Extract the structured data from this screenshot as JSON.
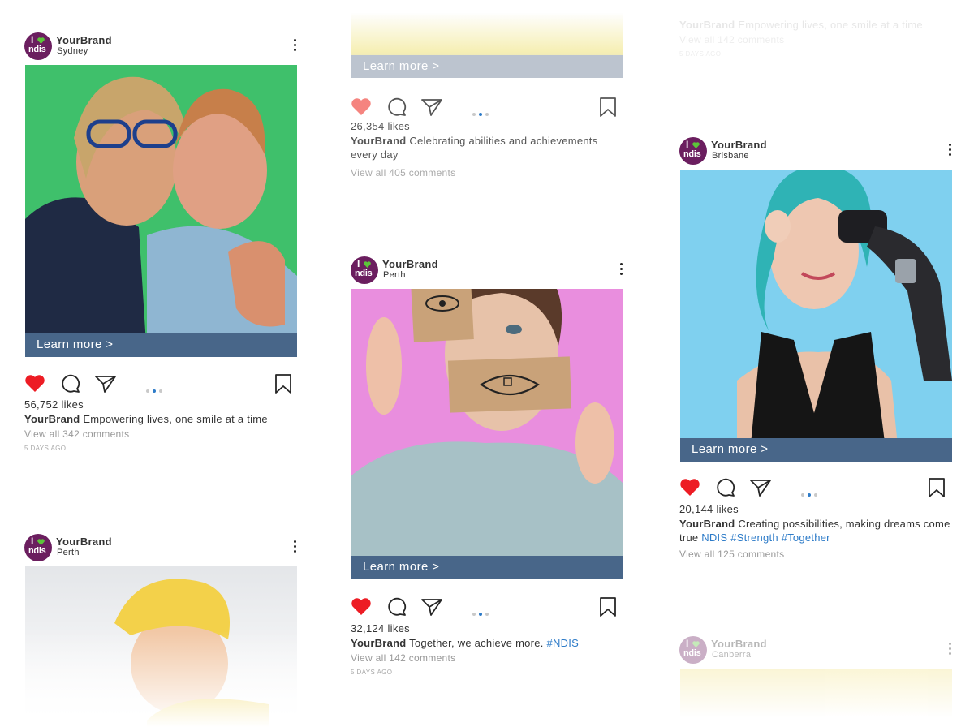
{
  "brand": {
    "name": "YourBrand",
    "logo_top": "I",
    "logo_bottom": "ndis",
    "logo_color": "#6b1e5f",
    "heart_color": "#5cc43a"
  },
  "cta_label": "Learn more >",
  "cta_color": "#486689",
  "like_color": "#ed1c24",
  "accent_color": "#2d7bc8",
  "posts": [
    {
      "location": "Sydney",
      "likes": "56,752 likes",
      "caption": "Empowering lives, one smile at a time",
      "hashtags": "",
      "comments": "View all 342 comments",
      "time": "5 DAYS AGO",
      "image": "woman-and-young-man-hugging-photo"
    },
    {
      "location": "Perth",
      "likes": "",
      "caption": "",
      "hashtags": "",
      "comments": "",
      "time": "",
      "image": "baby-in-yellow-hat-photo"
    },
    {
      "location": "",
      "likes": "26,354 likes",
      "caption": "Celebrating abilities and achievements every day",
      "hashtags": "",
      "comments": "View all 405 comments",
      "time": "",
      "image": "yellow-gradient-image"
    },
    {
      "location": "Perth",
      "likes": "32,124 likes",
      "caption": "Together, we achieve more.",
      "hashtags": "#NDIS",
      "comments": "View all 142 comments",
      "time": "5 DAYS AGO",
      "image": "woman-with-drawn-eye-and-mouth-cards-photo"
    },
    {
      "location": "",
      "likes": "",
      "caption": "Empowering lives, one smile at a time",
      "hashtags": "",
      "comments": "View all 142 comments",
      "time": "5 DAYS AGO",
      "image": ""
    },
    {
      "location": "Brisbane",
      "likes": "20,144 likes",
      "caption": "Creating possibilities, making dreams come true",
      "hashtags": "NDIS #Strength #Together",
      "comments": "View all 125 comments",
      "time": "",
      "image": "woman-with-blue-hair-and-bionic-arm-photo"
    },
    {
      "location": "Canberra",
      "likes": "",
      "caption": "",
      "hashtags": "",
      "comments": "",
      "time": "",
      "image": "yellow-gradient-image"
    }
  ],
  "icons": [
    "heart-icon",
    "comment-icon",
    "share-icon",
    "carousel-dots-icon",
    "bookmark-icon",
    "more-options-icon"
  ]
}
